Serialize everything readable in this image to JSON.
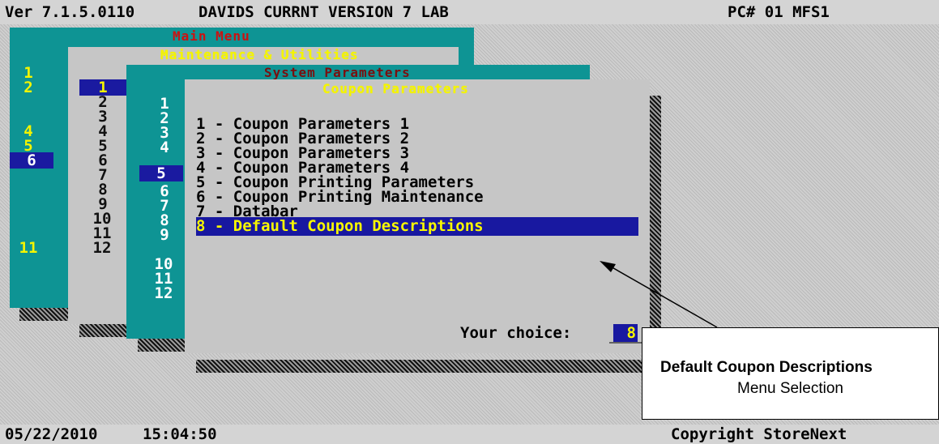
{
  "topbar": {
    "version": "Ver 7.1.5.0110",
    "store_name": "DAVIDS CURRNT VERSION 7 LAB",
    "pc": "PC# 01 MFS1"
  },
  "windows": {
    "main_menu": {
      "title": "Main Menu",
      "numbers": [
        "1",
        "2",
        "4",
        "5",
        "6",
        "11"
      ],
      "selected": "6"
    },
    "maintenance": {
      "title": "Maintenance & Utilities",
      "numbers": [
        "1",
        "2",
        "3",
        "4",
        "5",
        "6",
        "7",
        "8",
        "9",
        "10",
        "11",
        "12"
      ],
      "selected": "1"
    },
    "system_parameters": {
      "title": "System Parameters",
      "numbers": [
        "1",
        "2",
        "3",
        "4",
        "5",
        "6",
        "7",
        "8",
        "9",
        "10",
        "11",
        "12"
      ],
      "selected": "5"
    },
    "coupon_parameters": {
      "title": "Coupon Parameters",
      "items": [
        "1 - Coupon Parameters 1",
        "2 - Coupon Parameters 2",
        "3 - Coupon Parameters 3",
        "4 - Coupon Parameters 4",
        "5 - Coupon Printing Parameters",
        "6 - Coupon Printing Maintenance",
        "7 - Databar",
        "8 - Default Coupon Descriptions"
      ],
      "selected_index": 7,
      "choice_label": "Your choice:",
      "choice_value": "8"
    }
  },
  "callout": {
    "line1": "Default Coupon Descriptions",
    "line2": "Menu Selection"
  },
  "statusbar": {
    "date": "05/22/2010",
    "time": "15:04:50",
    "copyright": "Copyright StoreNext"
  }
}
